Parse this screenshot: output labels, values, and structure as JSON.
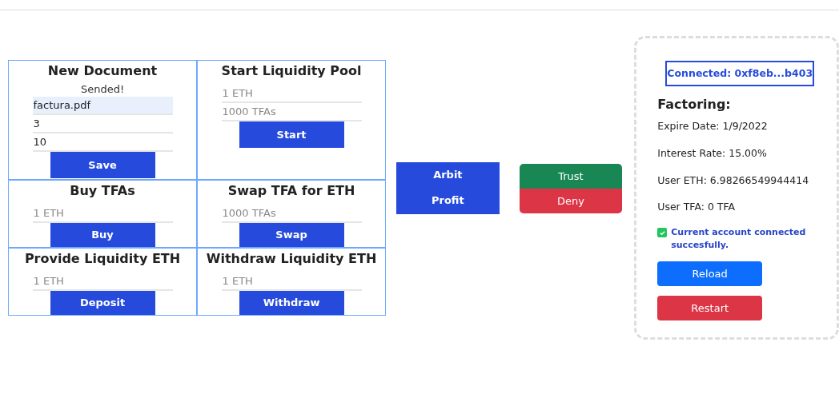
{
  "cards": [
    {
      "title": "New Document",
      "status": "Sended!",
      "fields": [
        {
          "value": "factura.pdf",
          "autofilled": true
        },
        {
          "value": "3",
          "autofilled": false
        },
        {
          "value": "10",
          "autofilled": false
        }
      ],
      "button": "Save"
    },
    {
      "title": "Start Liquidity Pool",
      "fields": [
        {
          "placeholder": "1 ETH",
          "autofilled": false
        },
        {
          "placeholder": "1000 TFAs",
          "autofilled": false
        }
      ],
      "button": "Start"
    },
    {
      "title": "Buy TFAs",
      "fields": [
        {
          "placeholder": "1 ETH",
          "autofilled": false
        }
      ],
      "button": "Buy"
    },
    {
      "title": "Swap TFA for ETH",
      "fields": [
        {
          "placeholder": "1000 TFAs",
          "autofilled": false
        }
      ],
      "button": "Swap"
    },
    {
      "title": "Provide Liquidity ETH",
      "fields": [
        {
          "placeholder": "1 ETH",
          "autofilled": false
        }
      ],
      "button": "Deposit"
    },
    {
      "title": "Withdraw Liquidity ETH",
      "fields": [
        {
          "placeholder": "1 ETH",
          "autofilled": false
        }
      ],
      "button": "Withdraw"
    }
  ],
  "arbit_buttons": [
    "Arbit",
    "Profit"
  ],
  "decision_buttons": [
    {
      "label": "Trust",
      "kind": "success"
    },
    {
      "label": "Deny",
      "kind": "danger"
    }
  ],
  "panel": {
    "connected": "Connected: 0xf8eb...b403",
    "heading": "Factoring:",
    "lines": [
      "Expire Date: 1/9/2022",
      "Interest Rate: 15.00%",
      "User ETH: 6.98266549944414",
      "User TFA: 0 TFA"
    ],
    "notice": {
      "checked": true,
      "text": "Current account connected succesfully."
    },
    "buttons": [
      {
        "label": "Reload",
        "kind": "primary"
      },
      {
        "label": "Restart",
        "kind": "danger"
      }
    ]
  }
}
